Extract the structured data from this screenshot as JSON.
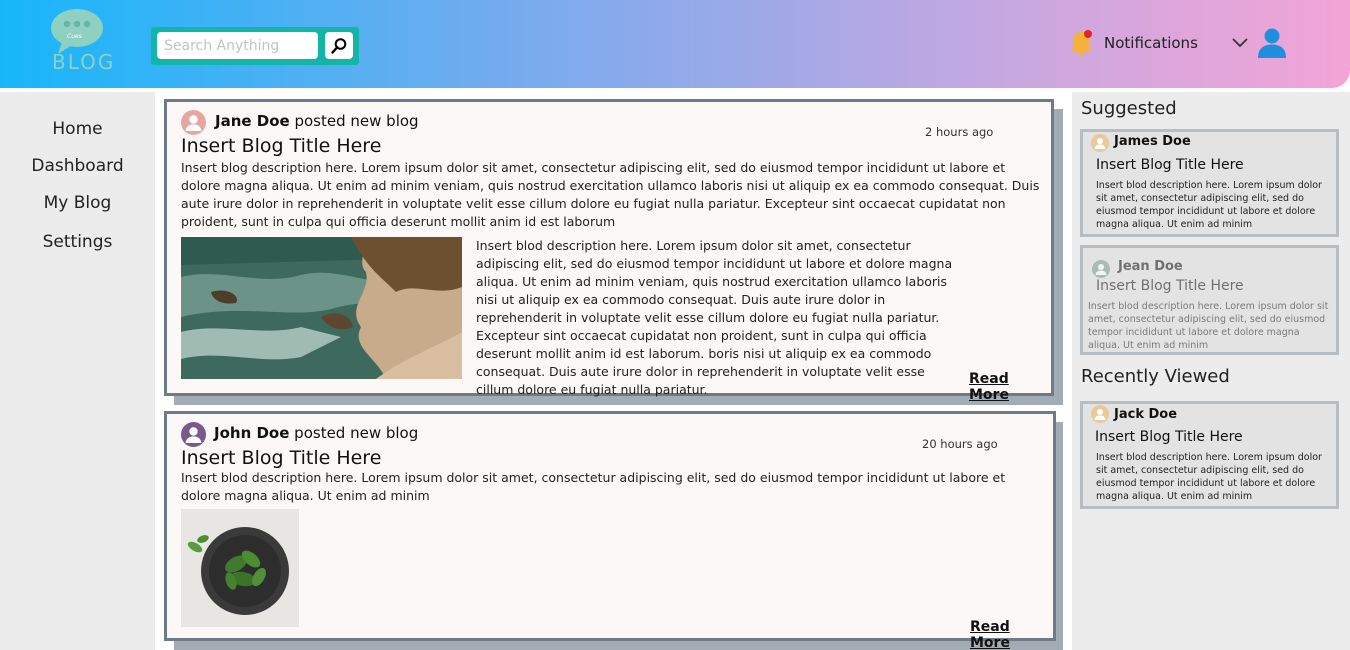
{
  "header": {
    "logo_text": "BLOG",
    "logo_small_text": "Cues",
    "search_placeholder": "Search Anything",
    "notifications_label": "Notifications"
  },
  "nav": {
    "items": [
      {
        "label": "Home"
      },
      {
        "label": "Dashboard"
      },
      {
        "label": "My Blog"
      },
      {
        "label": "Settings"
      }
    ]
  },
  "feed": {
    "posts": [
      {
        "author": "Jane Doe",
        "action": " posted new blog",
        "time": "2 hours ago",
        "title": "Insert Blog Title Here",
        "description": "Insert blog description here. Lorem ipsum dolor sit amet, consectetur adipiscing elit, sed do eiusmod tempor incididunt ut labore et dolore magna aliqua. Ut enim ad minim veniam, quis nostrud exercitation ullamco laboris nisi ut aliquip ex ea commodo consequat. Duis aute irure dolor in reprehenderit in voluptate velit esse cillum dolore eu fugiat nulla pariatur. Excepteur sint occaecat cupidatat non proident, sunt in culpa qui officia deserunt mollit anim id est laborum",
        "side_text": "Insert blod description here. Lorem ipsum dolor sit amet, consectetur adipiscing elit, sed do eiusmod tempor incididunt ut labore et dolore magna aliqua. Ut enim ad minim veniam, quis nostrud exercitation ullamco laboris nisi ut aliquip ex ea commodo consequat. Duis aute irure dolor in reprehenderit in voluptate velit esse cillum dolore eu fugiat nulla pariatur. Excepteur sint occaecat cupidatat non proident, sunt in culpa qui officia deserunt mollit anim id est laborum. boris nisi ut aliquip ex ea commodo consequat. Duis aute irure dolor in reprehenderit in voluptate velit esse cillum dolore eu fugiat nulla pariatur.",
        "read_more": "Read More"
      },
      {
        "author": "John Doe",
        "action": " posted new blog",
        "time": "20 hours ago",
        "title": "Insert Blog Title Here",
        "description": "Insert blod description here. Lorem ipsum dolor sit amet, consectetur adipiscing elit, sed do eiusmod tempor incididunt ut labore et dolore magna aliqua. Ut enim ad minim",
        "read_more": "Read More"
      }
    ]
  },
  "sidebar": {
    "suggested_title": "Suggested",
    "recently_viewed_title": "Recently Viewed",
    "suggested": [
      {
        "name": "James Doe",
        "title": "Insert Blog Title Here",
        "description": "Insert blod description here. Lorem ipsum dolor sit amet, consectetur adipiscing elit, sed do eiusmod tempor incididunt ut labore et dolore magna aliqua. Ut enim ad minim"
      },
      {
        "name": "Jean Doe",
        "title": "Insert Blog Title Here",
        "description": "Insert blod description here. Lorem ipsum dolor sit amet, consectetur adipiscing elit, sed do eiusmod tempor incididunt ut labore et dolore magna aliqua. Ut enim ad minim"
      }
    ],
    "recent": [
      {
        "name": "Jack Doe",
        "title": "Insert Blog Title Here",
        "description": "Insert blod description here. Lorem ipsum dolor sit amet, consectetur adipiscing elit, sed do eiusmod tempor incididunt ut labore et dolore magna aliqua. Ut enim ad minim"
      }
    ]
  },
  "colors": {
    "header_gradient_start": "#17b6fb",
    "header_gradient_end": "#f3a4d6",
    "search_box": "#13b5a8",
    "card_border": "#6e7a84",
    "bell": "#f7b23b",
    "user_icon": "#1f8fe0"
  }
}
